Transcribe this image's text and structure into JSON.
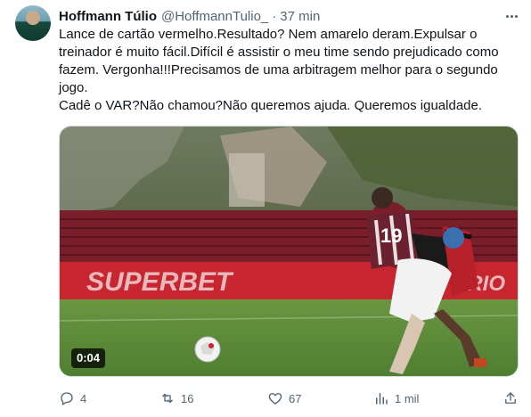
{
  "tweet": {
    "author_name": "Hoffmann Túlio",
    "author_handle": "@HoffmannTulio_",
    "separator": "·",
    "time": "37 min",
    "text": "Lance de cartão vermelho.Resultado? Nem amarelo deram.Expulsar o\ntreinador é muito fácil.Difícil é assistir o meu time sendo prejudicado como\nfazem. Vergonha!!!Precisamos de uma arbitragem melhor para o segundo\njogo.\nCadê o VAR?Não chamou?Não queremos ajuda. Queremos igualdade.",
    "video": {
      "duration": "0:04",
      "banner_text": "SUPERBET",
      "banner_text_right": "RRIO",
      "jersey_number": "19"
    }
  },
  "actions": {
    "replies": "4",
    "reposts": "16",
    "likes": "67",
    "views": "1 mil"
  },
  "colors": {
    "text": "#0f1419",
    "secondary": "#536471",
    "banner_red": "#c7262e",
    "pitch_green": "#5d8b3a"
  },
  "icons": [
    "more-icon",
    "reply-icon",
    "repost-icon",
    "like-icon",
    "views-icon",
    "share-icon"
  ]
}
